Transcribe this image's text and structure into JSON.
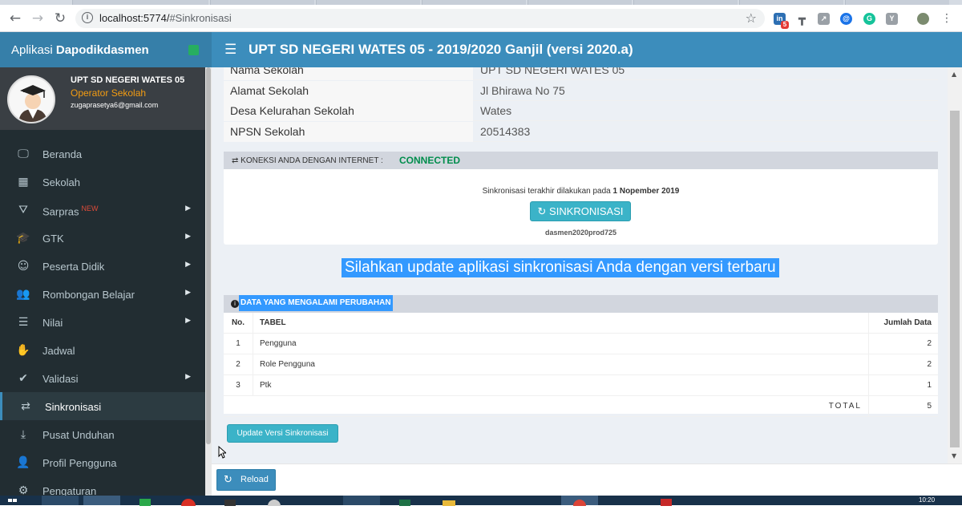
{
  "browser": {
    "url_host": "localhost:5774/",
    "url_path": "#Sinkronisasi",
    "extension_badge": "5",
    "ext_letter_y": "Y"
  },
  "app": {
    "brand_prefix": "Aplikasi ",
    "brand_name": "Dapodikdasmen",
    "header_title": "UPT SD NEGERI WATES 05 - 2019/2020 Ganjil (versi 2020.a)"
  },
  "user": {
    "name": "UPT SD NEGERI WATES 05",
    "role": "Operator Sekolah",
    "email": "zugaprasetya6@gmail.com"
  },
  "sidebar": {
    "items": [
      {
        "label": "Beranda",
        "icon": "monitor-icon",
        "glyph": "🖵",
        "arrow": false
      },
      {
        "label": "Sekolah",
        "icon": "building-icon",
        "glyph": "▦",
        "arrow": false
      },
      {
        "label": "Sarpras",
        "icon": "road-icon",
        "glyph": "⛛",
        "arrow": true,
        "badge": "NEW"
      },
      {
        "label": "GTK",
        "icon": "graduation-cap-icon",
        "glyph": "🎓",
        "arrow": true
      },
      {
        "label": "Peserta Didik",
        "icon": "smile-icon",
        "glyph": "☺",
        "arrow": true
      },
      {
        "label": "Rombongan Belajar",
        "icon": "users-icon",
        "glyph": "👥",
        "arrow": true
      },
      {
        "label": "Nilai",
        "icon": "list-icon",
        "glyph": "☰",
        "arrow": true
      },
      {
        "label": "Jadwal",
        "icon": "hand-icon",
        "glyph": "✋",
        "arrow": false
      },
      {
        "label": "Validasi",
        "icon": "check-icon",
        "glyph": "✔",
        "arrow": true
      },
      {
        "label": "Sinkronisasi",
        "icon": "exchange-icon",
        "glyph": "⇄",
        "arrow": false,
        "active": true
      },
      {
        "label": "Pusat Unduhan",
        "icon": "download-icon",
        "glyph": "⤓",
        "arrow": false
      },
      {
        "label": "Profil Pengguna",
        "icon": "user-icon",
        "glyph": "👤",
        "arrow": false
      },
      {
        "label": "Pengaturan",
        "icon": "gear-icon",
        "glyph": "⚙",
        "arrow": false
      }
    ]
  },
  "school_info": [
    {
      "key": "Nama Sekolah",
      "value": "UPT SD NEGERI WATES 05"
    },
    {
      "key": "Alamat Sekolah",
      "value": "Jl Bhirawa No 75"
    },
    {
      "key": "Desa Kelurahan Sekolah",
      "value": "Wates"
    },
    {
      "key": "NPSN Sekolah",
      "value": "20514383"
    }
  ],
  "connection": {
    "label": "KONEKSI ANDA DENGAN INTERNET :",
    "status": "CONNECTED",
    "last_sync_prefix": "Sinkronisasi terakhir dilakukan pada ",
    "last_sync_date": "1 Nopember 2019",
    "sync_button": "SINKRONISASI",
    "server_code": "dasmen2020prod725"
  },
  "update_message": "Silahkan update aplikasi sinkronisasi Anda dengan versi terbaru",
  "changes": {
    "title": "DATA YANG MENGALAMI PERUBAHAN",
    "headers": {
      "no": "No.",
      "table": "TABEL",
      "count": "Jumlah Data"
    },
    "rows": [
      {
        "no": "1",
        "table": "Pengguna",
        "count": "2"
      },
      {
        "no": "2",
        "table": "Role Pengguna",
        "count": "2"
      },
      {
        "no": "3",
        "table": "Ptk",
        "count": "1"
      }
    ],
    "total_label": "TOTAL",
    "total_value": "5"
  },
  "buttons": {
    "update_version": "Update Versi Sinkronisasi",
    "reload": "Reload"
  },
  "taskbar": {
    "clock": "10:20"
  },
  "colors": {
    "header_blue": "#3c8dbc",
    "sidebar_dark": "#222d32",
    "connected_green": "#008d4c",
    "highlight_blue": "#3399ff"
  }
}
